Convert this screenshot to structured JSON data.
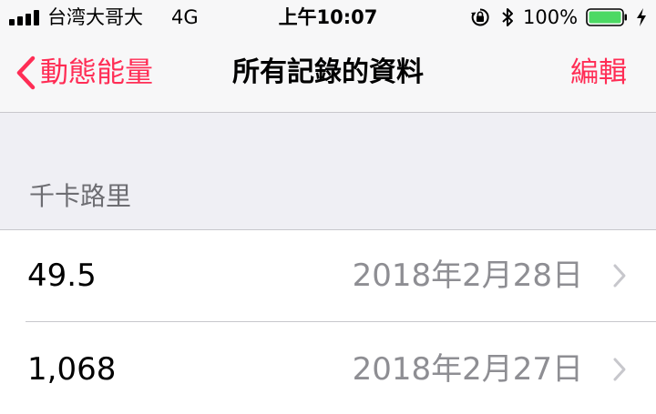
{
  "status_bar": {
    "carrier": "台湾大哥大",
    "network": "4G",
    "time": "上午10:07",
    "battery_percent": "100%",
    "battery_level": 1.0,
    "battery_color": "#4cd964",
    "icons": [
      "signal-icon",
      "orientation-lock-icon",
      "bluetooth-icon",
      "battery-icon",
      "charging-icon"
    ]
  },
  "nav": {
    "back_label": "動態能量",
    "title": "所有記錄的資料",
    "edit_label": "編輯",
    "accent_color": "#ff2d55"
  },
  "section": {
    "header": "千卡路里"
  },
  "records": [
    {
      "value": "49.5",
      "date": "2018年2月28日"
    },
    {
      "value": "1,068",
      "date": "2018年2月27日"
    }
  ]
}
